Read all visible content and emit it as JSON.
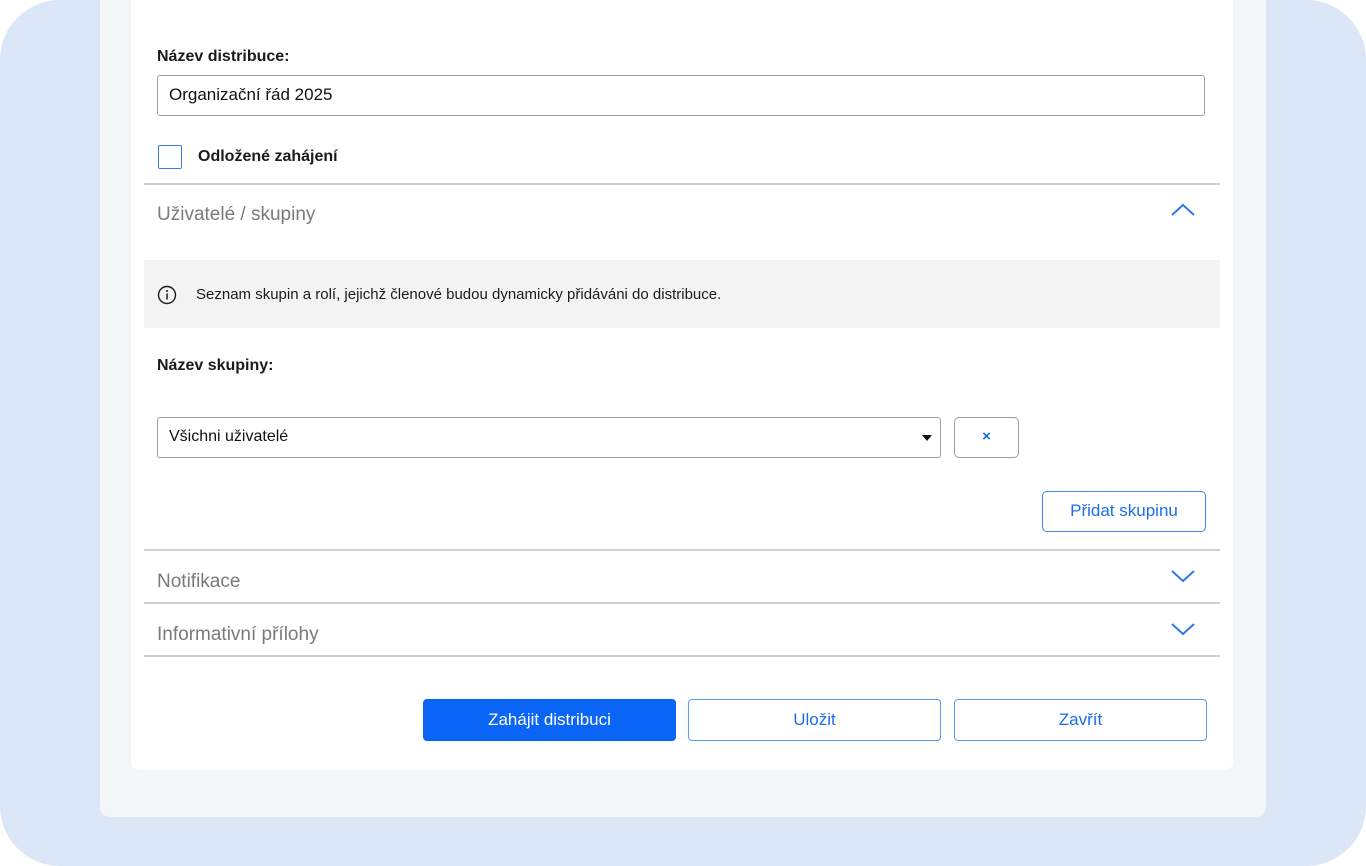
{
  "form": {
    "name_label": "Název distribuce:",
    "name_value": "Organizační řád 2025",
    "delayed_start_label": "Odložené zahájení"
  },
  "sections": {
    "users": {
      "title": "Uživatelé / skupiny",
      "info_text": "Seznam skupin a rolí, jejichž členové budou dynamicky přidáváni do distribuce.",
      "group_label": "Název skupiny:",
      "group_value": "Všichni uživatelé",
      "remove_label": "×",
      "add_group_label": "Přidat skupinu",
      "expanded": true
    },
    "notifications": {
      "title": "Notifikace",
      "expanded": false
    },
    "attachments": {
      "title": "Informativní přílohy",
      "expanded": false
    }
  },
  "footer": {
    "start_label": "Zahájit distribuci",
    "save_label": "Uložit",
    "close_label": "Zavřít"
  },
  "icons": {
    "info": "info-icon",
    "chevron_up": "chevron-up-icon",
    "chevron_down": "chevron-down-icon",
    "dropdown": "caret-down-icon"
  },
  "colors": {
    "accent": "#0a64f5",
    "accent_text": "#1a6cf0",
    "outer_background": "#dbe6f6",
    "panel_background": "#f5f6f8",
    "info_background": "#f3f3f3"
  }
}
